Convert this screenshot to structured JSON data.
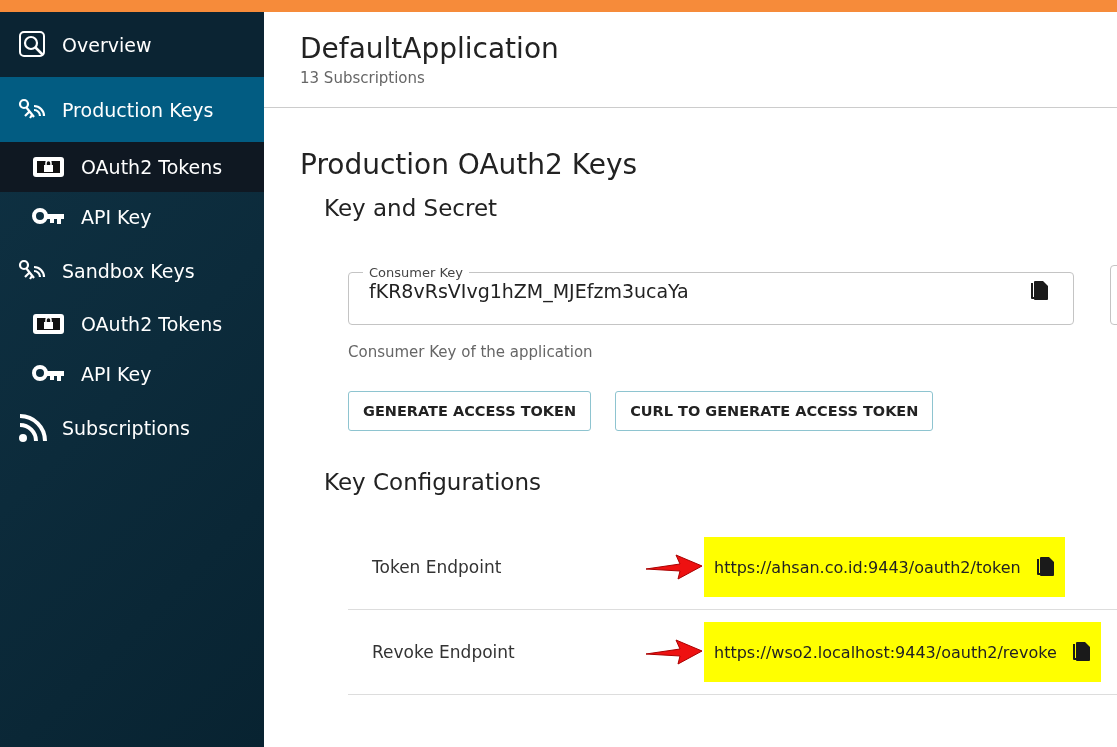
{
  "sidebar": {
    "items": [
      {
        "label": "Overview",
        "selected": false
      },
      {
        "label": "Production Keys",
        "selected": true,
        "children": [
          {
            "label": "OAuth2 Tokens",
            "selected": true
          },
          {
            "label": "API Key",
            "selected": false
          }
        ]
      },
      {
        "label": "Sandbox Keys",
        "selected": false,
        "children": [
          {
            "label": "OAuth2 Tokens",
            "selected": false
          },
          {
            "label": "API Key",
            "selected": false
          }
        ]
      },
      {
        "label": "Subscriptions",
        "selected": false
      }
    ]
  },
  "header": {
    "title": "DefaultApplication",
    "subtitle": "13 Subscriptions"
  },
  "page_title": "Production OAuth2 Keys",
  "section_title": "Key and Secret",
  "fields": [
    {
      "label": "Consumer Key",
      "value": "fKR8vRsVIvg1hZM_MJEfzm3ucaYa",
      "helper": "Consumer Key of the application"
    }
  ],
  "buttons": [
    "GENERATE ACCESS TOKEN",
    "CURL TO GENERATE ACCESS TOKEN"
  ],
  "config_title": "Key Configurations",
  "endpoints": [
    {
      "label": "Token Endpoint",
      "value": "https://ahsan.co.id:9443/oauth2/token",
      "highlighted": true
    },
    {
      "label": "Revoke Endpoint",
      "value": "https://wso2.localhost:9443/oauth2/revoke",
      "highlighted": true
    }
  ]
}
